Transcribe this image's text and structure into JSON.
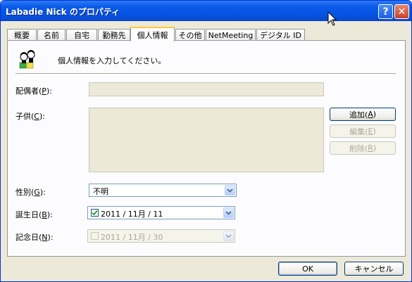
{
  "window": {
    "title": "Labadie Nick のプロパティ",
    "help": "?",
    "close": "✕"
  },
  "tabs": [
    "概要",
    "名前",
    "自宅",
    "勤務先",
    "個人情報",
    "その他",
    "NetMeeting",
    "デジタル ID"
  ],
  "active_tab": 4,
  "header": {
    "text": "個人情報を入力してください。"
  },
  "spouse": {
    "label": "配偶者(",
    "key": "P",
    "end": "):"
  },
  "children": {
    "label": "子供(",
    "key": "C",
    "end": "):"
  },
  "buttons": {
    "add": {
      "label": "追加(",
      "key": "A",
      "end": ")"
    },
    "edit": {
      "label": "編集(",
      "key": "E",
      "end": ")"
    },
    "remove": {
      "label": "削除(",
      "key": "R",
      "end": ")"
    }
  },
  "gender": {
    "label": "性別(",
    "key": "G",
    "end": "):",
    "value": "不明"
  },
  "birthday": {
    "label": "誕生日(",
    "key": "B",
    "end": "):",
    "value": "2011 / 11月 / 11",
    "checked": true
  },
  "anniversary": {
    "label": "記念日(",
    "key": "N",
    "end": "):",
    "value": "2011 / 11月 / 30",
    "checked": false
  },
  "footer": {
    "ok": "OK",
    "cancel": "キャンセル"
  }
}
